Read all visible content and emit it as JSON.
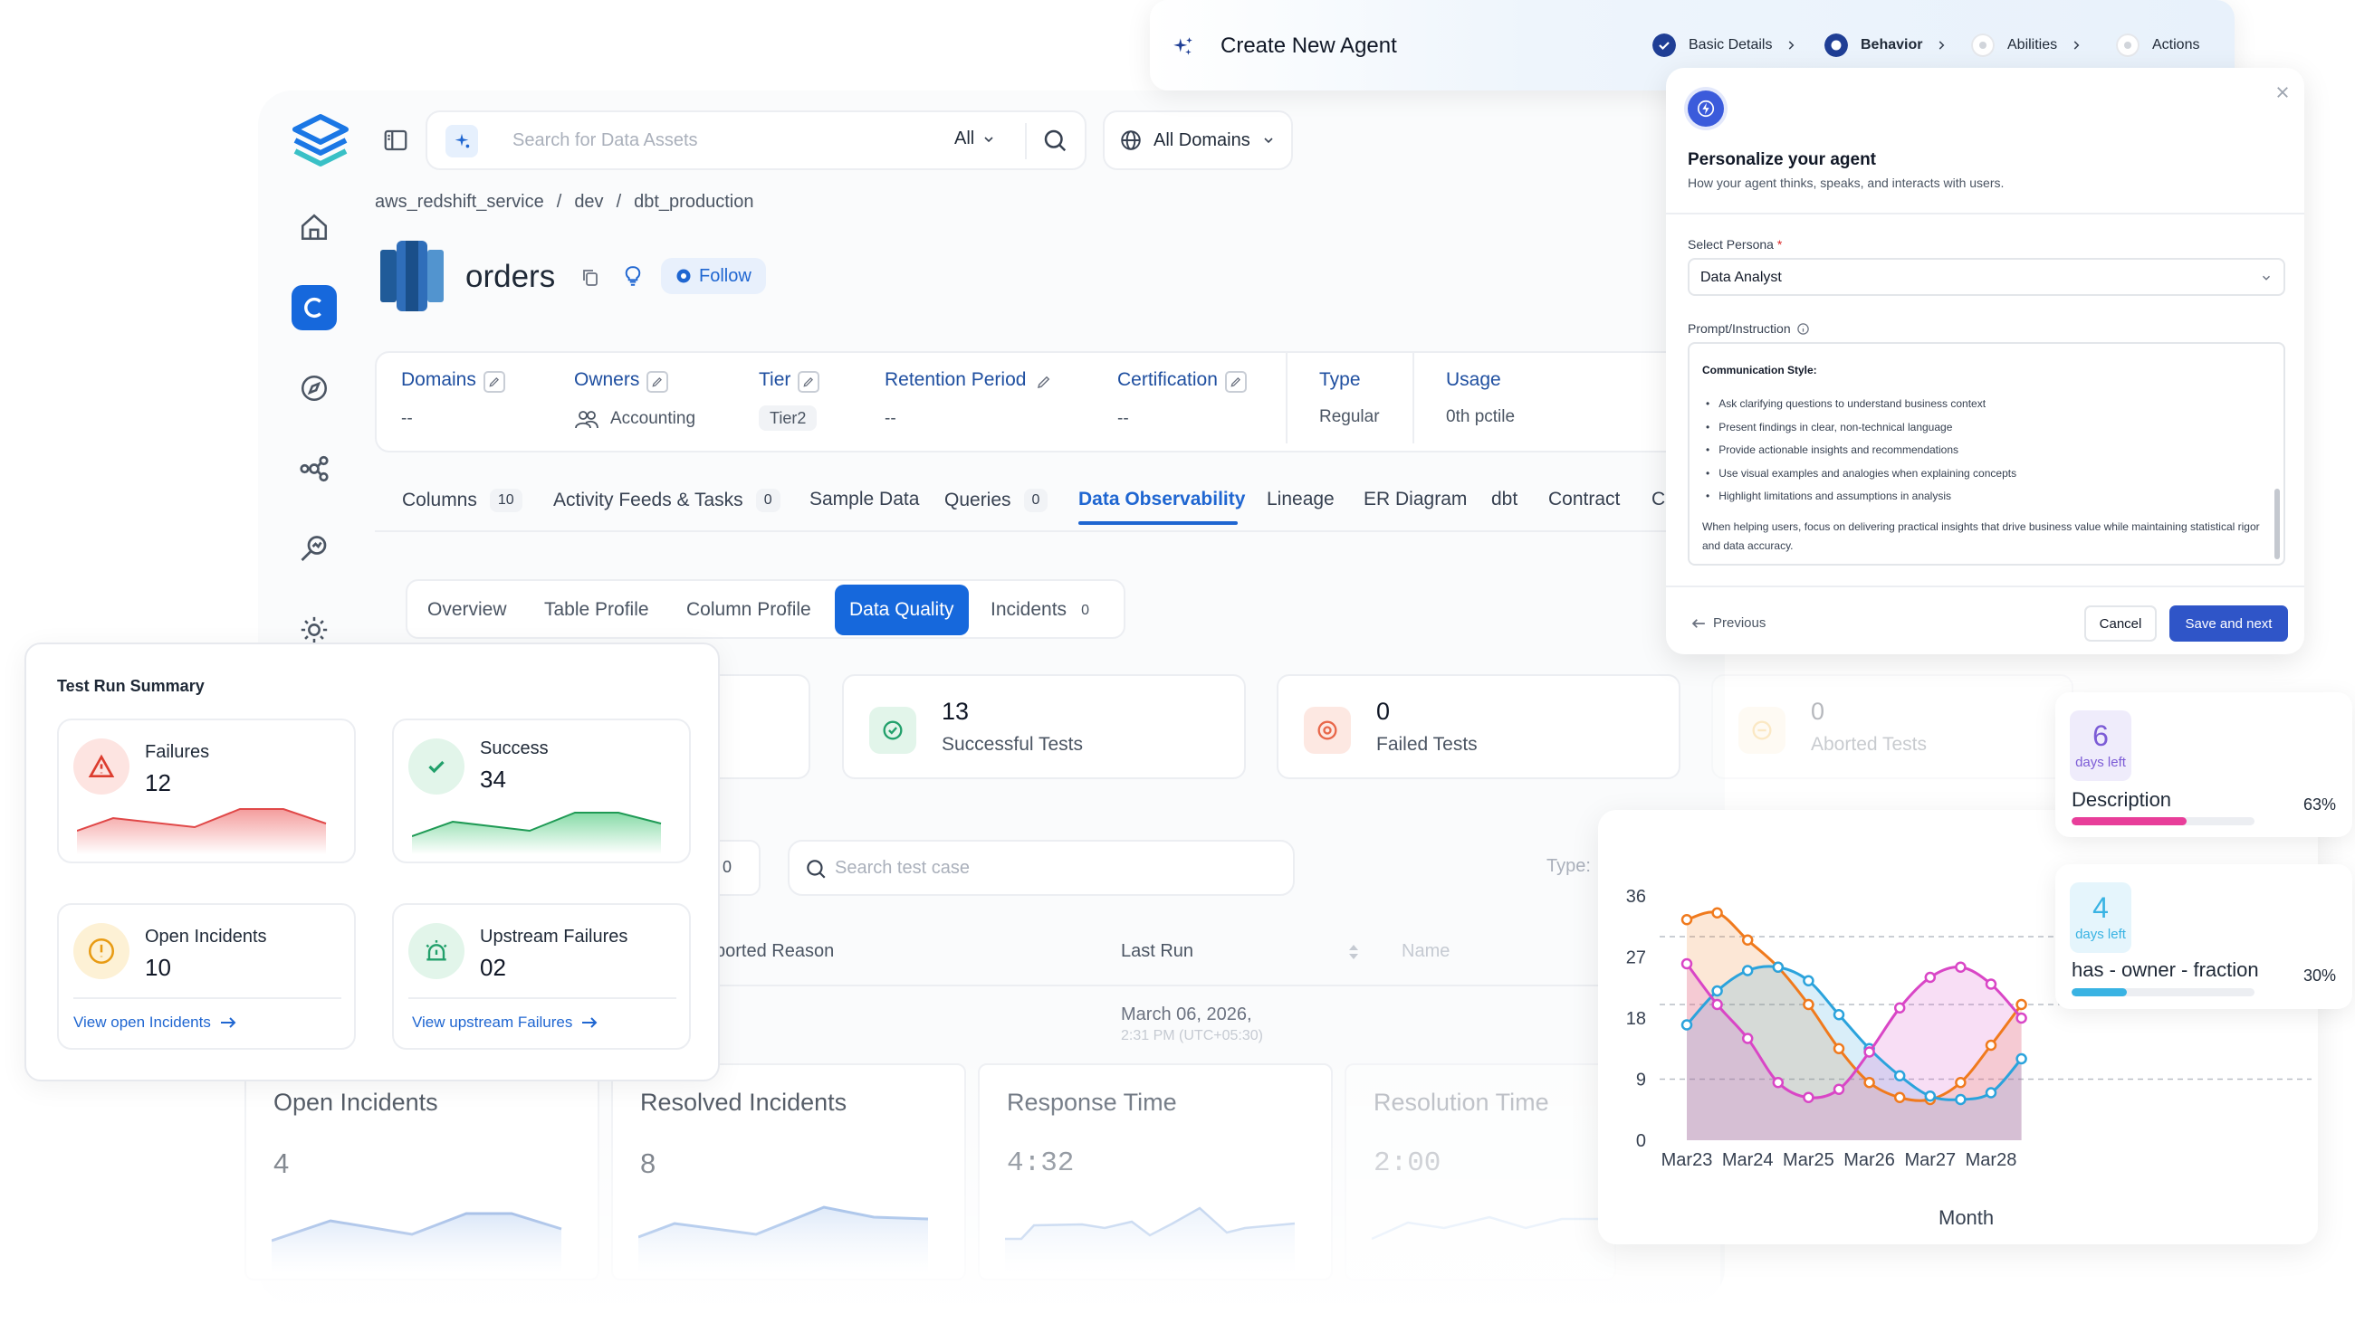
{
  "wizard": {
    "title": "Create New Agent",
    "steps": [
      {
        "label": "Basic Details",
        "state": "done"
      },
      {
        "label": "Behavior",
        "state": "current"
      },
      {
        "label": "Abilities",
        "state": "pending"
      },
      {
        "label": "Actions",
        "state": "pending"
      }
    ],
    "heading": "Personalize your agent",
    "subheading": "How your agent thinks, speaks, and interacts with users.",
    "persona_label": "Select Persona",
    "required_mark": "*",
    "persona_value": "Data Analyst",
    "prompt_label": "Prompt/Instruction",
    "prompt_heading": "Communication Style:",
    "prompt_bullets": [
      "Ask clarifying questions to understand business context",
      "Present findings in clear, non-technical language",
      "Provide actionable insights and recommendations",
      "Use visual examples and analogies when explaining concepts",
      "Highlight limitations and assumptions in analysis"
    ],
    "prompt_footer": "When helping users, focus on delivering practical insights that drive business value while maintaining statistical rigor and data accuracy.",
    "previous_label": "Previous",
    "cancel_label": "Cancel",
    "save_label": "Save and next"
  },
  "search": {
    "placeholder": "Search for Data Assets",
    "filter": "All",
    "domain": "All Domains"
  },
  "breadcrumb": [
    "aws_redshift_service",
    "dev",
    "dbt_production"
  ],
  "entity": {
    "name": "orders",
    "follow_label": "Follow"
  },
  "meta": [
    {
      "label": "Domains",
      "value": "--",
      "editable": true
    },
    {
      "label": "Owners",
      "value": "Accounting",
      "editable": true
    },
    {
      "label": "Tier",
      "value": "Tier2",
      "editable": true
    },
    {
      "label": "Retention Period",
      "value": "--",
      "editable": true
    },
    {
      "label": "Certification",
      "value": "--",
      "editable": true
    },
    {
      "label": "Type",
      "value": "Regular",
      "editable": false
    },
    {
      "label": "Usage",
      "value": "0th pctile",
      "editable": false
    }
  ],
  "tabs": [
    {
      "label": "Columns",
      "count": "10"
    },
    {
      "label": "Activity Feeds & Tasks",
      "count": "0"
    },
    {
      "label": "Sample Data",
      "count": ""
    },
    {
      "label": "Queries",
      "count": "0"
    },
    {
      "label": "Data Observability",
      "count": "",
      "active": true
    },
    {
      "label": "Lineage",
      "count": ""
    },
    {
      "label": "ER Diagram",
      "count": ""
    },
    {
      "label": "dbt",
      "count": ""
    },
    {
      "label": "Contract",
      "count": ""
    },
    {
      "label": "Cu",
      "count": ""
    }
  ],
  "subtabs": [
    {
      "label": "Overview"
    },
    {
      "label": "Table Profile"
    },
    {
      "label": "Column Profile"
    },
    {
      "label": "Data Quality",
      "active": true
    },
    {
      "label": "Incidents",
      "count": "0"
    }
  ],
  "stats": [
    {
      "value": "13",
      "label": "Successful Tests",
      "color": "#22a06b"
    },
    {
      "value": "0",
      "label": "Failed Tests",
      "color": "#e8674a"
    },
    {
      "value": "0",
      "label": "Aborted Tests",
      "color": "#f2b53f"
    }
  ],
  "table": {
    "search_placeholder": "Search test case",
    "filter_count": "0",
    "type_label": "Type:",
    "col_aborted": "borted Reason",
    "col_lastrun": "Last Run",
    "col_name": "Name",
    "row_date": "March 06, 2026,",
    "row_time": "2:31 PM (UTC+05:30)"
  },
  "summary": {
    "title": "Test Run Summary",
    "failures_label": "Failures",
    "failures_value": "12",
    "success_label": "Success",
    "success_value": "34",
    "open_label": "Open Incidents",
    "open_value": "10",
    "upstream_label": "Upstream Failures",
    "upstream_value": "02",
    "view_open": "View open Incidents",
    "view_upstream": "View upstream Failures"
  },
  "incidents": [
    {
      "label": "Open Incidents",
      "value": "4"
    },
    {
      "label": "Resolved Incidents",
      "value": "8"
    },
    {
      "label": "Response Time",
      "value": "4:32"
    },
    {
      "label": "Resolution Time",
      "value": "2:00"
    }
  ],
  "kpis": [
    {
      "days": "6",
      "days_label": "days left",
      "title": "Description",
      "percent_label": "63%",
      "fraction": 0.63,
      "color": "#e83e9a",
      "accent": "#7c5cd6"
    },
    {
      "days": "4",
      "days_label": "days left",
      "title": "has - owner - fraction",
      "percent_label": "30%",
      "fraction": 0.3,
      "color": "#39b3e3",
      "accent": "#39b3e3"
    }
  ],
  "chart_data": {
    "type": "area",
    "categories": [
      "Mar23",
      "Mar24",
      "Mar25",
      "Mar26",
      "Mar27",
      "Mar28"
    ],
    "xlabel": "Month",
    "ylabel": "",
    "ylim": [
      0,
      36
    ],
    "yticks": [
      0,
      9,
      18,
      27,
      36
    ],
    "reference_lines": [
      9,
      20,
      30
    ],
    "x": [
      0,
      0.5,
      1,
      1.5,
      2,
      2.5,
      3,
      3.5,
      4,
      4.5,
      5,
      5.5
    ],
    "series": [
      {
        "values": [
          32.5,
          33.5,
          29.5,
          25.5,
          20,
          13.5,
          8.5,
          6.3,
          6,
          8.5,
          14,
          20
        ],
        "color": "#f07a1d"
      },
      {
        "values": [
          17,
          22,
          25,
          25.5,
          23.5,
          18.5,
          13.5,
          9.5,
          6.5,
          6,
          7,
          12
        ],
        "color": "#2ba3dc"
      },
      {
        "values": [
          26,
          20,
          15,
          8.5,
          6.3,
          7.5,
          13,
          19.5,
          24,
          25.5,
          23,
          18
        ],
        "color": "#d946c6"
      }
    ]
  },
  "colors": {
    "brand": "#1668dc",
    "success": "#22a06b",
    "danger": "#e8674a",
    "warning": "#f2b53f"
  }
}
